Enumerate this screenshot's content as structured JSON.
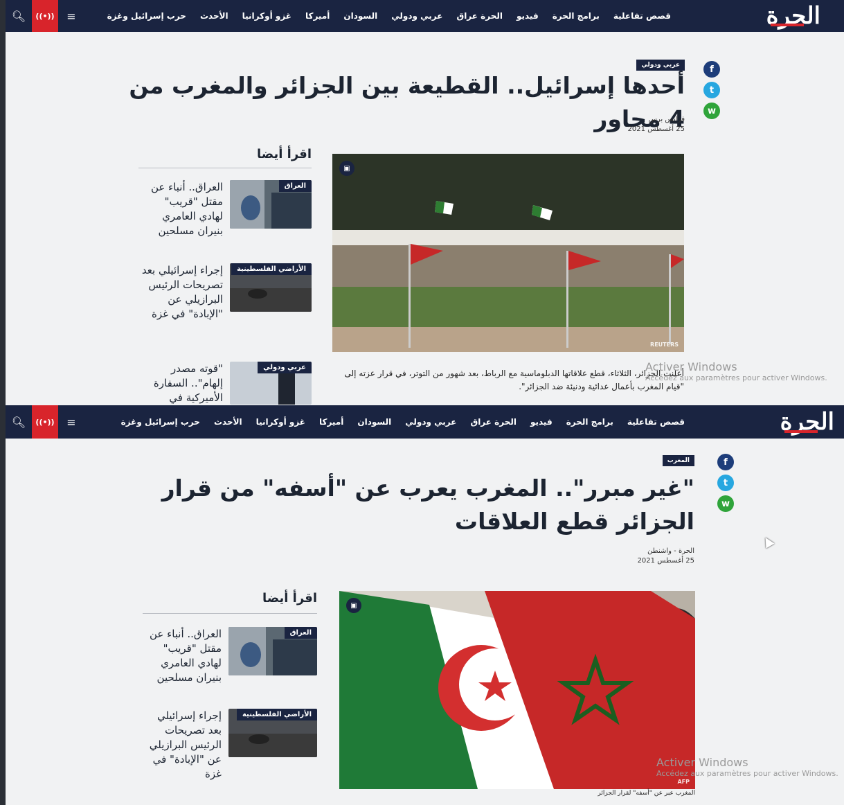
{
  "nav": {
    "logo": "الحرة",
    "items": [
      "حرب إسرائيل وغزة",
      "الأحدث",
      "غزو أوكرانيا",
      "أميركا",
      "السودان",
      "عربي ودولي",
      "الحرة عراق",
      "فيديو",
      "برامج الحرة",
      "قصص تفاعلية"
    ],
    "live_icon": "live-broadcast-icon",
    "menu_icon": "hamburger-menu-icon",
    "search_icon": "search-icon"
  },
  "colors": {
    "nav_bg": "#1a2441",
    "live_red": "#d8242b",
    "page_bg": "#f1f2f3"
  },
  "article1": {
    "category": "عربي ودولي",
    "headline": "أحدها إسرائيل.. القطيعة بين الجزائر والمغرب من 4 محاور",
    "source": "فرانس برس",
    "date": "25 أغسطس 2021",
    "image_credit": "REUTERS",
    "caption": "أعلنت الجزائر، الثلاثاء، قطع علاقاتها الدبلوماسية مع الرباط، بعد شهور من التوتر، في قرار عزته إلى \"قيام المغرب بأعمال عدائية ودنيئة ضد الجزائر\"."
  },
  "article2": {
    "category": "المغرب",
    "headline": "\"غير مبرر\".. المغرب يعرب عن \"أسفه\" من قرار الجزائر قطع العلاقات",
    "source": "الحرة - واشنطن",
    "date": "25 أغسطس 2021",
    "image_credit": "AFP",
    "caption": "المغرب عبر عن \"أسفه\" لقرار الجزائر"
  },
  "also_read": {
    "title": "اقرأ أيضا",
    "items": [
      {
        "tag": "العراق",
        "text": "العراق.. أنباء عن مقتل \"قريب\" لهادي العامري بنيران مسلحين"
      },
      {
        "tag": "الأراضي الفلسطينية",
        "text": "إجراء إسرائيلي بعد تصريحات الرئيس البرازيلي عن \"الإبادة\" في غزة"
      },
      {
        "tag": "عربي ودولي",
        "text": "\"قوته مصدر إلهام\".. السفارة الأميركية في"
      }
    ]
  },
  "watermark": {
    "title": "Activer Windows",
    "subtitle": "Accédez aux paramètres pour activer Windows."
  }
}
